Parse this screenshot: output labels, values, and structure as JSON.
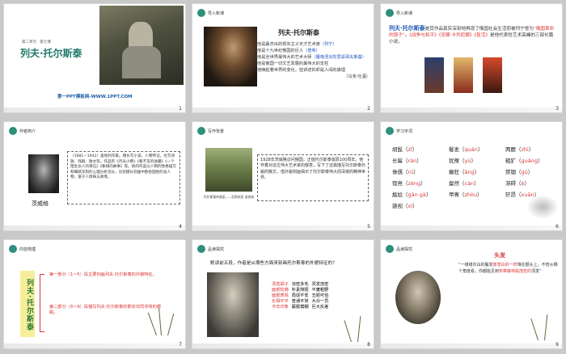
{
  "slides": [
    {
      "id": 1,
      "number": "1",
      "kicker": "第二单元 · 第七课",
      "title": "列夫·托尔斯泰",
      "footer_link": "第一PPT模板网-WWW.1PPT.COM"
    },
    {
      "id": 2,
      "number": "2",
      "section": "导入新课",
      "heading": "列夫·托尔斯泰",
      "lines": [
        {
          "text": "他是最杰出的现实主义天才艺术家",
          "note": "（列宁）"
        },
        {
          "text": "他是十九世纪俄国的巨人",
          "note": "（普希）"
        },
        {
          "text": "他是全世界最伟大的艺术大师",
          "note": "（屠格涅夫陀思妥耶夫斯基）"
        },
        {
          "text": "他是俄国一切文艺发展的最伟大的支柱",
          "note": ""
        },
        {
          "text": "他唤起着世界的变化，但讲述的却是人间的真理",
          "note": "（马克·吐温）"
        }
      ]
    },
    {
      "id": 3,
      "number": "3",
      "section": "导入新课",
      "intro_name": "列夫·托尔斯泰",
      "intro_text": "是其作品真实深刻地再现了俄国社会生活而被列宁誉为",
      "intro_quote": "“俄国革命的镜子”",
      "intro_text2": "。",
      "works": [
        "《战争与和平》",
        "《安娜·卡列尼娜》",
        "《复活》"
      ],
      "works_tail": "是他代表性艺术高峰的三部长篇小说。"
    },
    {
      "id": 4,
      "number": "4",
      "section": "作者简介",
      "caption": "茨威格",
      "bio": "（1881—1942）奥地利作家。擅长写小说、人物传记，也写诗歌、戏剧、散文等。作品有《月光小巷》《看不见的收藏》《一个陌生女人的来信》《象棋的故事》等。他的作品以人物的性格描写和细腻深刻的心理分析见长，比较擅长刻画中欧各国各阶层人物，富于人情味与真情。"
    },
    {
      "id": 5,
      "number": "5",
      "section": "写作背景",
      "caption": "托尔斯泰的故居——亚斯纳亚·波良纳",
      "text": "1928年茨威格访问俄国，正值托尔斯泰诞辰100周年。他怀着对这位伟大艺术家的敬意，写下了这篇描写托尔斯泰外貌的散文，借外貌刻画揭示了托尔斯泰伟大而深邃的精神世界。"
    },
    {
      "id": 6,
      "number": "6",
      "section": "学习字词",
      "vocab": [
        {
          "word": "胡髭",
          "py": "zī"
        },
        {
          "word": "鬈发",
          "py": "quán"
        },
        {
          "word": "两腮",
          "py": "zhì"
        },
        {
          "word": "长髯",
          "py": "rán"
        },
        {
          "word": "犹豫",
          "py": "yù"
        },
        {
          "word": "粗犷",
          "py": "ɡuǎnɡ"
        },
        {
          "word": "侏儒",
          "py": "rú"
        },
        {
          "word": "癫狂",
          "py": "ānɡ"
        },
        {
          "word": "禁锢",
          "py": "ɡù"
        },
        {
          "word": "铿亮",
          "py": "zènɡ"
        },
        {
          "word": "粲然",
          "py": "càn"
        },
        {
          "word": "滞碍",
          "py": "è"
        },
        {
          "word": "尴尬",
          "py": "ɡān ɡà"
        },
        {
          "word": "甲胄",
          "py": "zhòu"
        },
        {
          "word": "轩昂",
          "py": "xuān"
        },
        {
          "word": "藐视",
          "py": "xì"
        }
      ]
    },
    {
      "id": 7,
      "number": "7",
      "section": "内容梳理",
      "vbar": "列夫·托尔斯泰",
      "part1": "第一部分（1～5）段主要刻画列夫·托尔斯泰的外貌特征。",
      "part2": "第二部分（6～9）段描写列夫·托尔斯泰的那双非同寻常的眼睛。"
    },
    {
      "id": 8,
      "number": "8",
      "section": "品读探究",
      "question": "默读前五段，作者是从哪些方面来刻画托尔斯泰的外貌特征的？",
      "rows": [
        [
          "须发胡子",
          "浓密多毛",
          "须发茂密"
        ],
        [
          "面部轮廓",
          "朴素简陋",
          "平庸粗野"
        ],
        [
          "面部表情",
          "局促不安",
          "丑陋可怕"
        ],
        [
          "长相平平",
          "普通平常",
          "大众一员"
        ],
        [
          "今年印象",
          "朦胧模糊",
          "巨大反差"
        ]
      ]
    },
    {
      "id": 9,
      "number": "9",
      "section": "品读探究",
      "sub": "头发",
      "quote_a": "“一缕缕灰白的鬈发",
      "quote_b": "像雪白的一样",
      "quote_c": "堆在额头上，不管从哪个角度看，你都能见到",
      "quote_d": "热带森林般茂密的",
      "quote_e": "须发”"
    }
  ]
}
